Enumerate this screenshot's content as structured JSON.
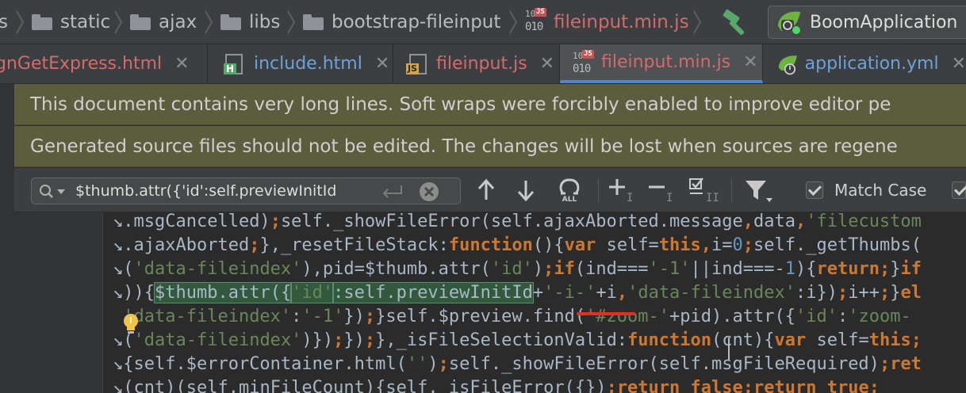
{
  "breadcrumb": {
    "items": [
      {
        "label": "s",
        "icon": "folder-icon"
      },
      {
        "label": "static",
        "icon": "folder-icon"
      },
      {
        "label": "ajax",
        "icon": "folder-icon"
      },
      {
        "label": "libs",
        "icon": "folder-icon"
      },
      {
        "label": "bootstrap-fileinput",
        "icon": "folder-icon"
      },
      {
        "label": "fileinput.min.js",
        "icon": "minified-js-file-icon"
      }
    ],
    "file_icon_text": {
      "top": "10",
      "bottom": "010",
      "badge": "JS"
    }
  },
  "toolbar": {
    "build_icon": "hammer-icon",
    "run_config_label": "BoomApplication",
    "run_config_icon": "spring-boot-icon"
  },
  "tabs": [
    {
      "label": "gnGetExpress.html",
      "color": "#d46a6a",
      "close": "✕",
      "active": false
    },
    {
      "label": "include.html",
      "icon_letter": "H",
      "color": "#6fa0d8",
      "close": "✕",
      "active": false
    },
    {
      "label": "fileinput.js",
      "icon_letter": "JS",
      "color": "#d46a6a",
      "close": "✕",
      "active": false
    },
    {
      "label": "fileinput.min.js",
      "icon_top": "10",
      "icon_bottom": "010",
      "icon_badge": "JS",
      "color": "#d46a6a",
      "close": "✕",
      "active": true
    },
    {
      "label": "application.yml",
      "color": "#6fa0d8",
      "close": "✕",
      "active": false
    }
  ],
  "banners": {
    "soft_wrap": "This document contains very long lines. Soft wraps were forcibly enabled to improve editor pe",
    "generated": "Generated source files should not be edited. The changes will be lost when sources are regene"
  },
  "find": {
    "query": "$thumb.attr({'id':self.previewInitId",
    "match_case_label": "Match Case",
    "match_case_checked": true,
    "regex_icon_text": "ALL"
  },
  "code": {
    "lines": [
      [
        {
          "t": ".msgCancelled)",
          "c": ""
        },
        {
          "t": ";",
          "c": "kw"
        },
        {
          "t": "self._showFileError(self.ajaxAborted.message",
          "c": ""
        },
        {
          "t": ",",
          "c": "kw"
        },
        {
          "t": "data",
          "c": ""
        },
        {
          "t": ",",
          "c": "kw"
        },
        {
          "t": "'filecustom",
          "c": "str"
        }
      ],
      [
        {
          "t": ".ajaxAborted",
          "c": ""
        },
        {
          "t": ";",
          "c": "kw"
        },
        {
          "t": "},_resetFileStack:",
          "c": ""
        },
        {
          "t": "function",
          "c": "kw"
        },
        {
          "t": "(){",
          "c": ""
        },
        {
          "t": "var ",
          "c": "kw"
        },
        {
          "t": "self=",
          "c": ""
        },
        {
          "t": "this",
          "c": "kw"
        },
        {
          "t": ",",
          "c": "kw"
        },
        {
          "t": "i=",
          "c": ""
        },
        {
          "t": "0",
          "c": "num"
        },
        {
          "t": ";",
          "c": "kw"
        },
        {
          "t": "self._getThumbs(",
          "c": ""
        }
      ],
      [
        {
          "t": "(",
          "c": ""
        },
        {
          "t": "'data-fileindex'",
          "c": "str"
        },
        {
          "t": "),pid=$thumb.attr(",
          "c": ""
        },
        {
          "t": "'id'",
          "c": "str"
        },
        {
          "t": ")",
          "c": ""
        },
        {
          "t": ";",
          "c": "kw"
        },
        {
          "t": "if",
          "c": "kw"
        },
        {
          "t": "(ind===",
          "c": ""
        },
        {
          "t": "'-1'",
          "c": "str"
        },
        {
          "t": "||ind===-",
          "c": ""
        },
        {
          "t": "1",
          "c": "num"
        },
        {
          "t": "){",
          "c": ""
        },
        {
          "t": "return",
          "c": "kw"
        },
        {
          "t": ";",
          "c": "kw"
        },
        {
          "t": "}",
          "c": ""
        },
        {
          "t": "if",
          "c": "kw"
        }
      ],
      [
        {
          "t": "))",
          "c": ""
        },
        {
          "t": "{",
          "c": ""
        },
        {
          "t": "$thumb.attr({",
          "c": "m"
        },
        {
          "t": "'id'",
          "c": "mstr"
        },
        {
          "t": ":self.previewInitId",
          "c": "m"
        },
        {
          "t": "+",
          "c": ""
        },
        {
          "t": "'-i-'",
          "c": "str"
        },
        {
          "t": "+i",
          "c": ""
        },
        {
          "t": ",",
          "c": "kw"
        },
        {
          "t": "'data-fileindex'",
          "c": "str"
        },
        {
          "t": ":i})",
          "c": ""
        },
        {
          "t": ";",
          "c": "kw"
        },
        {
          "t": "i++",
          "c": ""
        },
        {
          "t": ";",
          "c": "kw"
        },
        {
          "t": "}",
          "c": ""
        },
        {
          "t": "el",
          "c": "kw"
        }
      ],
      [
        {
          "t": "'data-fileindex'",
          "c": "str"
        },
        {
          "t": ":",
          "c": ""
        },
        {
          "t": "'-1'",
          "c": "str"
        },
        {
          "t": "})",
          "c": ""
        },
        {
          "t": ";",
          "c": "kw"
        },
        {
          "t": "}self.$preview.find(",
          "c": ""
        },
        {
          "t": "'#zoom-'",
          "c": "str"
        },
        {
          "t": "+pid).attr({",
          "c": ""
        },
        {
          "t": "'id'",
          "c": "str"
        },
        {
          "t": ":",
          "c": ""
        },
        {
          "t": "'zoom-",
          "c": "str"
        }
      ],
      [
        {
          "t": "(",
          "c": ""
        },
        {
          "t": "'data-fileindex'",
          "c": "str"
        },
        {
          "t": ")})",
          "c": ""
        },
        {
          "t": ";",
          "c": "kw"
        },
        {
          "t": "})",
          "c": ""
        },
        {
          "t": ";",
          "c": "kw"
        },
        {
          "t": "},_isFileSelectionValid:",
          "c": ""
        },
        {
          "t": "function",
          "c": "kw"
        },
        {
          "t": "(cnt){",
          "c": ""
        },
        {
          "t": "var ",
          "c": "kw"
        },
        {
          "t": "self=",
          "c": ""
        },
        {
          "t": "this",
          "c": "kw"
        },
        {
          "t": ";",
          "c": "kw"
        }
      ],
      [
        {
          "t": "{self.$errorContainer.html(",
          "c": ""
        },
        {
          "t": "''",
          "c": "str"
        },
        {
          "t": ")",
          "c": ""
        },
        {
          "t": ";",
          "c": "kw"
        },
        {
          "t": "self._showFileError(self.msgFileRequired)",
          "c": ""
        },
        {
          "t": ";",
          "c": "kw"
        },
        {
          "t": "ret",
          "c": "kw"
        }
      ],
      [
        {
          "t": "(cnt)",
          "c": ""
        },
        {
          "t": "(self.minFileCount)",
          "c": ""
        },
        {
          "t": "{self._isFileError({})",
          "c": ""
        },
        {
          "t": ";",
          "c": "kw"
        },
        {
          "t": "return ",
          "c": "kw"
        },
        {
          "t": "false",
          "c": "kw"
        },
        {
          "t": ";",
          "c": "kw"
        },
        {
          "t": "return ",
          "c": "kw"
        },
        {
          "t": "true",
          "c": "kw"
        },
        {
          "t": ";",
          "c": "kw"
        }
      ]
    ],
    "wrap_marks": [
      "wrap",
      "wrap",
      "wrap",
      "wrap",
      "none",
      "wrap",
      "wrap",
      "wrap"
    ]
  }
}
